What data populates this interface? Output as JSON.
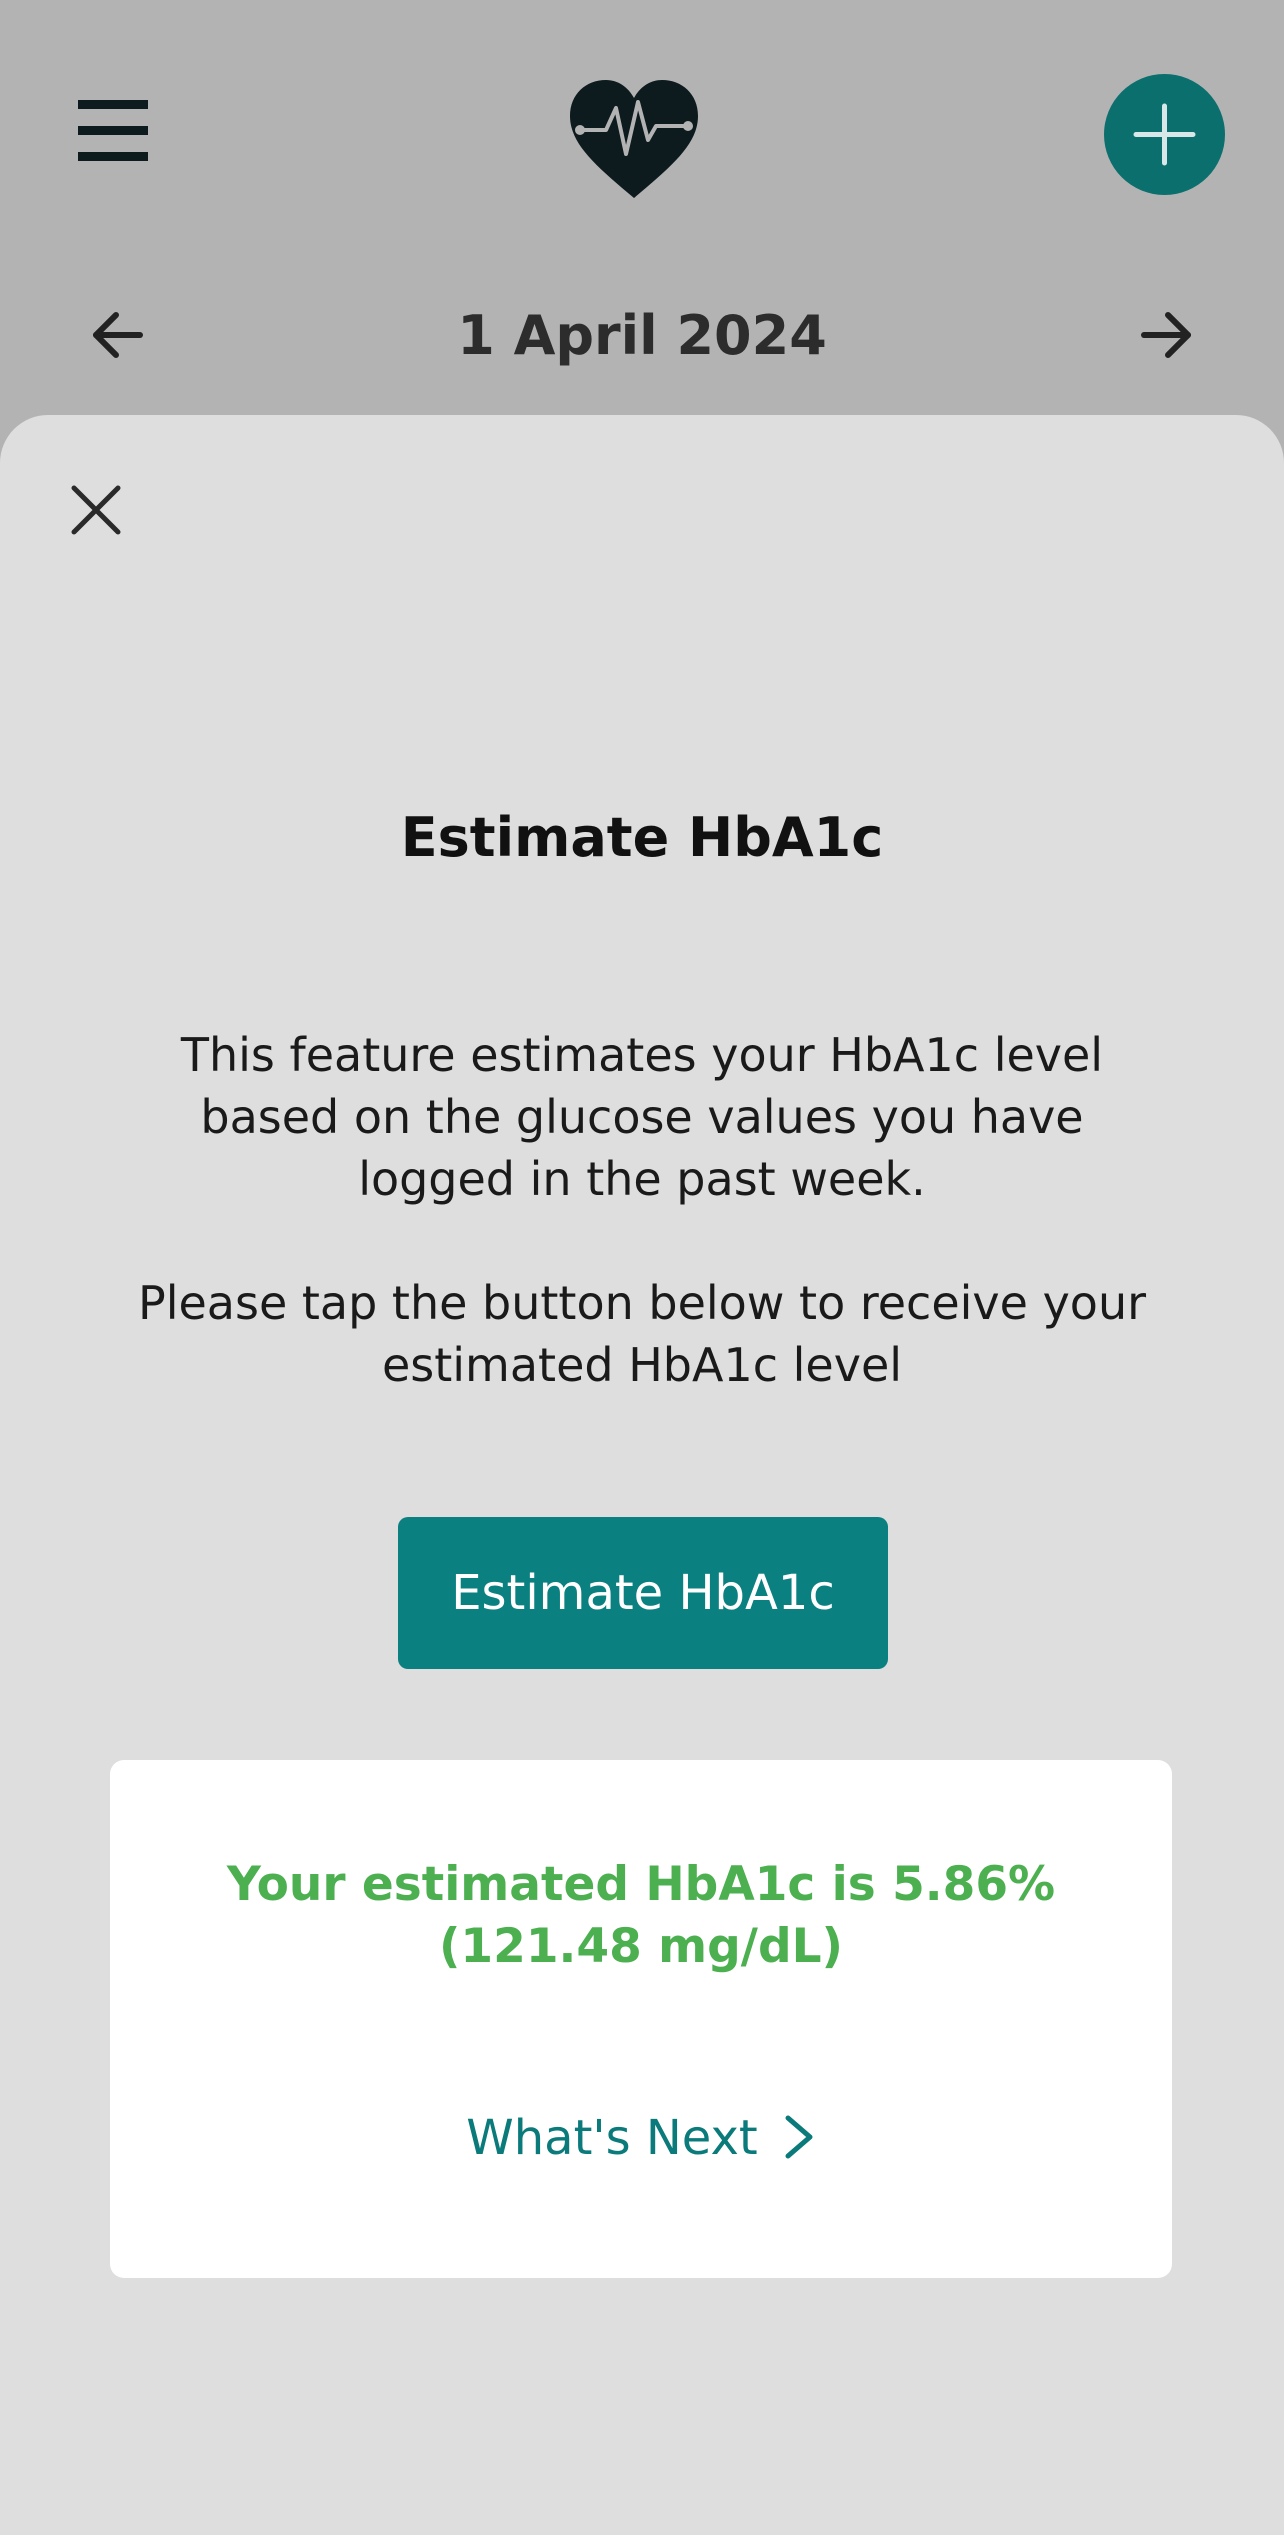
{
  "header": {
    "date": "1 April 2024",
    "icons": {
      "menu": "hamburger-menu-icon",
      "logo": "heart-pulse-icon",
      "add": "plus-icon",
      "prev": "arrow-left-icon",
      "next": "arrow-right-icon"
    },
    "accent_color": "#0b6f6e"
  },
  "sheet": {
    "close_icon": "close-icon",
    "title": "Estimate HbA1c",
    "description_1": "This feature estimates your HbA1c level based on the glucose values you have logged in the past week.",
    "description_2": "Please tap the button below to receive your estimated HbA1c level",
    "button_label": "Estimate HbA1c",
    "button_color": "#0b8080",
    "result": {
      "line_1": "Your estimated HbA1c is 5.86%",
      "line_2": "(121.48 mg/dL)",
      "color": "#4caf50"
    },
    "next_link": "What's Next",
    "next_icon": "chevron-right-icon"
  }
}
